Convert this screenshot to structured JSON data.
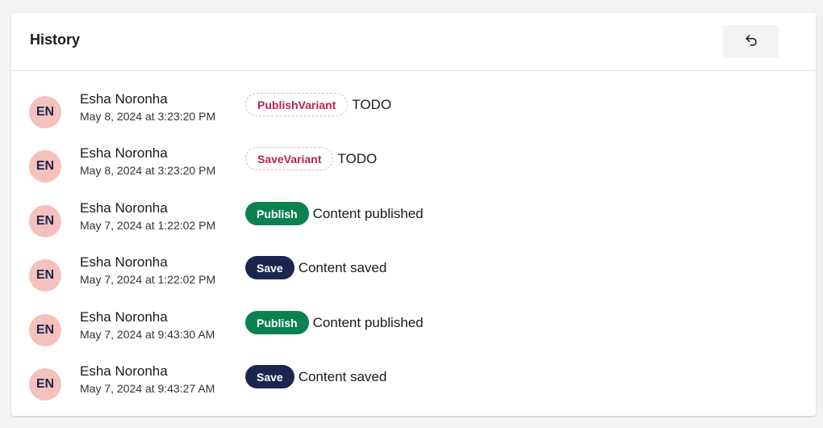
{
  "panel": {
    "title": "History",
    "rollback_icon": "undo-icon"
  },
  "colors": {
    "avatar_bg": "#f5c1bc",
    "publish": "#0b8152",
    "save": "#1b264f",
    "variant_text": "#b5254b"
  },
  "entries": [
    {
      "initials": "EN",
      "name": "Esha Noronha",
      "date": "May 8, 2024 at 3:23:20 PM",
      "tag": "PublishVariant",
      "tag_style": "outline",
      "text": "TODO"
    },
    {
      "initials": "EN",
      "name": "Esha Noronha",
      "date": "May 8, 2024 at 3:23:20 PM",
      "tag": "SaveVariant",
      "tag_style": "outline",
      "text": "TODO"
    },
    {
      "initials": "EN",
      "name": "Esha Noronha",
      "date": "May 7, 2024 at 1:22:02 PM",
      "tag": "Publish",
      "tag_style": "publish",
      "text": "Content published"
    },
    {
      "initials": "EN",
      "name": "Esha Noronha",
      "date": "May 7, 2024 at 1:22:02 PM",
      "tag": "Save",
      "tag_style": "save",
      "text": "Content saved"
    },
    {
      "initials": "EN",
      "name": "Esha Noronha",
      "date": "May 7, 2024 at 9:43:30 AM",
      "tag": "Publish",
      "tag_style": "publish",
      "text": "Content published"
    },
    {
      "initials": "EN",
      "name": "Esha Noronha",
      "date": "May 7, 2024 at 9:43:27 AM",
      "tag": "Save",
      "tag_style": "save",
      "text": "Content saved"
    }
  ]
}
